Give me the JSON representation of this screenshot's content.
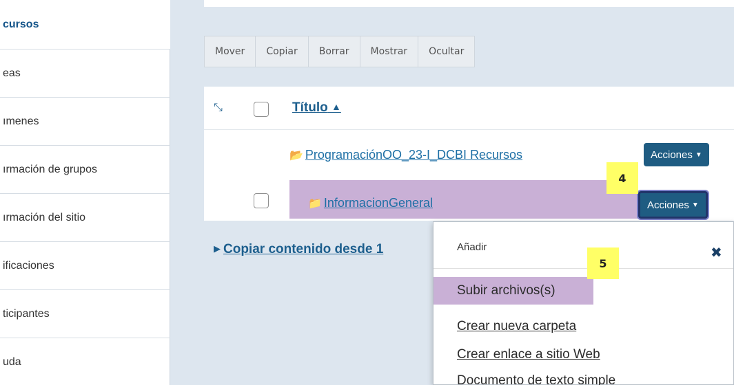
{
  "sidebar": {
    "items": [
      {
        "label": "cursos",
        "active": true
      },
      {
        "label": "eas"
      },
      {
        "label": "ımenes"
      },
      {
        "label": "ırmación de grupos"
      },
      {
        "label": "ırmación del sitio"
      },
      {
        "label": "ificaciones"
      },
      {
        "label": "ticipantes"
      },
      {
        "label": "uda"
      }
    ]
  },
  "toolbar": {
    "mover": "Mover",
    "copiar": "Copiar",
    "borrar": "Borrar",
    "mostrar": "Mostrar",
    "ocultar": "Ocultar"
  },
  "table": {
    "header_title": "Título",
    "parent_folder": "ProgramaciónOO_23-I_DCBI Recursos",
    "folder": "InformacionGeneral",
    "actions_label": "Acciones"
  },
  "badges": {
    "step4": "4",
    "step5": "5"
  },
  "copy_link": "Copiar contenido desde 1",
  "dropdown": {
    "title": "Añadir",
    "items": [
      "Subir archivos(s)",
      "Crear nueva carpeta",
      "Crear enlace a sitio Web",
      "Documento de texto simple"
    ]
  },
  "colors": {
    "accent": "#1f5c82",
    "highlight": "#c9b0d6",
    "badge": "#ffff66"
  }
}
